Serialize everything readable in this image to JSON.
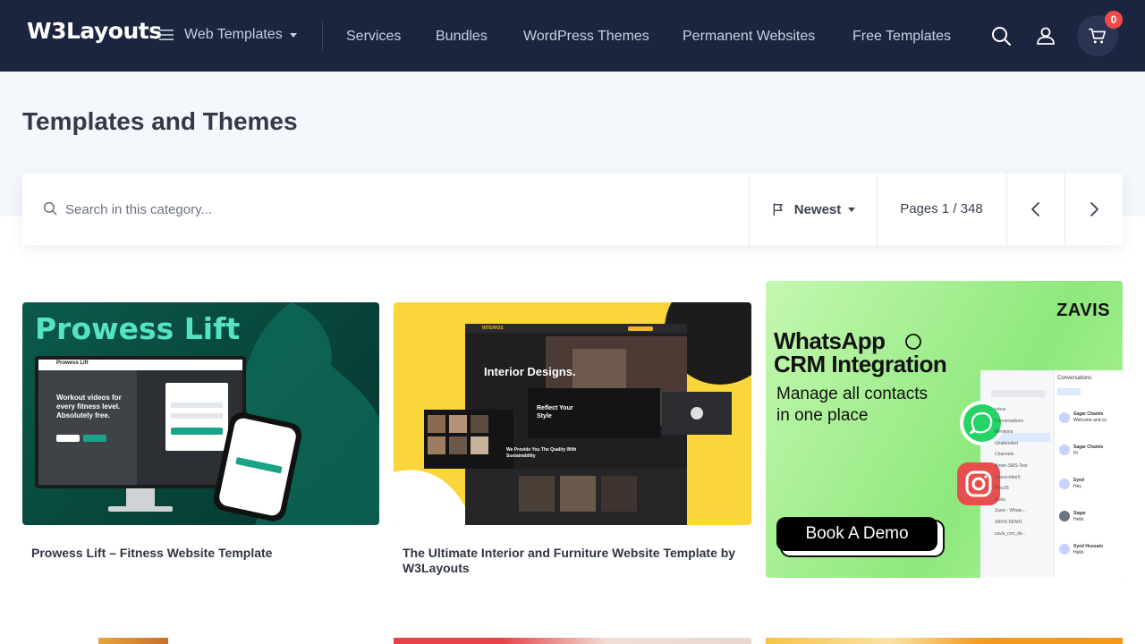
{
  "header": {
    "logo": "W3Layouts",
    "menu_label": "Web Templates",
    "nav": [
      "Services",
      "Bundles",
      "WordPress Themes",
      "Permanent Websites",
      "Free Templates"
    ],
    "cart_count": "0"
  },
  "page": {
    "title": "Templates and Themes"
  },
  "toolbar": {
    "search_placeholder": "Search in this category...",
    "sort_label": "Newest",
    "pages_label": "Pages 1 / 348"
  },
  "cards": [
    {
      "title": "Prowess Lift – Fitness Website Template",
      "thumb": {
        "headline": "Prowess Lift",
        "site_name": "Prowess Lift",
        "tagline": "Workout videos for every fitness level. Absolutely free."
      }
    },
    {
      "title": "The Ultimate Interior and Furniture Website Template by W3Layouts",
      "thumb": {
        "brand": "INTERIOS",
        "headline": "Interior Designs.",
        "subheading": "Reflect Your Style",
        "lower": "We Provide You The Quality With Sustainability"
      }
    },
    {
      "title": "",
      "ad": {
        "brand": "ZAVIS",
        "headline_line1": "WhatsApp",
        "headline_line2": "CRM Integration",
        "sub_line1": "Manage all contacts",
        "sub_line2": "in one place",
        "cta": "Book A Demo",
        "panel_title": "Conversations",
        "panel_sidebar": [
          "Inbox",
          "Conversations",
          "Mentions",
          "Unattended",
          "Channels",
          "Aman-SMS-Test",
          "spacecriber5",
          "Woo25",
          "Zavis",
          "Zavis - Whats...",
          "ZAVIS DEMO",
          "zavis_crm_de..."
        ],
        "panel_contacts": [
          {
            "name": "Sagar Chamle",
            "msg": "Welcome and co"
          },
          {
            "name": "Sagar Chamle",
            "msg": "Hi"
          },
          {
            "name": "Syed",
            "msg": "Hey"
          },
          {
            "name": "Sagar",
            "msg": "Hello"
          },
          {
            "name": "Syed Hussain",
            "msg": "Hello"
          }
        ]
      }
    }
  ],
  "colors": {
    "header_bg": "#1c2540",
    "hero_bg": "#f4f7fb",
    "badge": "#f04a4a"
  }
}
